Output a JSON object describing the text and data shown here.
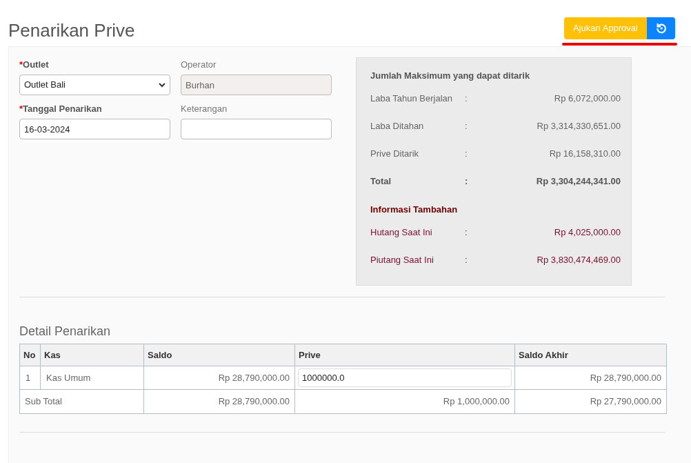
{
  "page": {
    "title": "Penarikan Prive"
  },
  "submit_button": {
    "label": "Ajukan Approval"
  },
  "form": {
    "fields": [
      {
        "label": "Outlet",
        "required": true,
        "marker": "*",
        "kind": "select",
        "value": "Outlet Bali",
        "disabled": false
      },
      {
        "label": "Operator",
        "required": false,
        "kind": "text",
        "value": "Burhan",
        "disabled": true
      },
      {
        "label": "Tanggal Penarikan",
        "required": true,
        "marker": "*",
        "kind": "text",
        "value": "16-03-2024",
        "disabled": false
      },
      {
        "label": "Keterangan",
        "required": false,
        "kind": "text",
        "disabled": false
      }
    ]
  },
  "summary": {
    "title": "Jumlah Maksimum yang dapat ditarik",
    "rows": [
      {
        "label": "Laba Tahun Berjalan",
        "separator": ":",
        "value": "Rp 6,072,000.00",
        "kind": "normal"
      },
      {
        "label": "Laba Ditahan",
        "separator": ":",
        "value": "Rp 3,314,330,651.00",
        "kind": "normal"
      },
      {
        "label": "Prive Ditarik",
        "separator": ":",
        "value": "Rp 16,158,310.00",
        "kind": "normal"
      },
      {
        "label": "Total",
        "separator": ":",
        "value": "Rp 3,304,244,341.00",
        "kind": "total"
      }
    ],
    "extra_title": "Informasi Tambahan",
    "extra_rows": [
      {
        "label": "Hutang Saat Ini",
        "separator": ":",
        "value": "Rp 4,025,000.00",
        "kind": "info"
      },
      {
        "label": "Piutang Saat Ini",
        "separator": ":",
        "value": "Rp 3,830,474,469.00",
        "kind": "info"
      }
    ]
  },
  "detail": {
    "title": "Detail Penarikan",
    "columns": [
      "No",
      "Kas",
      "Saldo",
      "Prive",
      "Saldo Akhir"
    ],
    "rows": [
      {
        "no": "1",
        "kas": "Kas Umum",
        "saldo": "Rp 28,790,000.00",
        "prive": "1000000.0",
        "saldo_akhir": "Rp 28,790,000.00"
      }
    ],
    "footer": {
      "label": "Sub Total",
      "saldo": "Rp 28,790,000.00",
      "prive": "Rp 1,000,000.00",
      "saldo_akhir": "Rp 27,790,000.00"
    }
  }
}
